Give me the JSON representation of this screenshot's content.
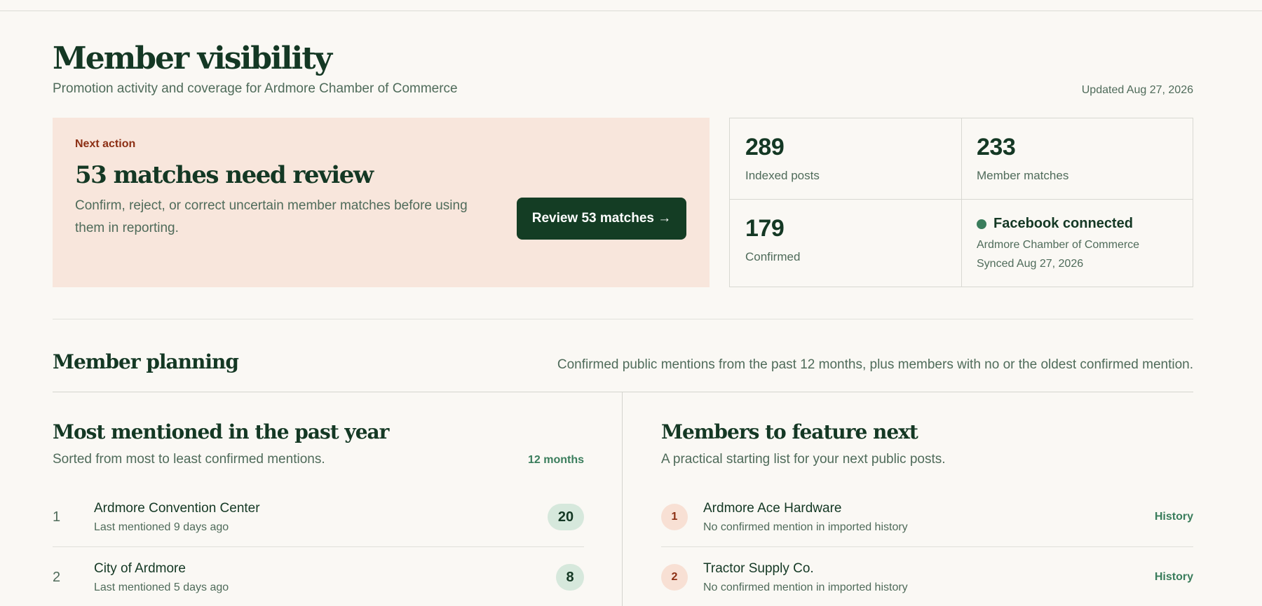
{
  "header": {
    "title": "Member visibility",
    "subtitle": "Promotion activity and coverage for Ardmore Chamber of Commerce",
    "updated": "Updated Aug 27, 2026"
  },
  "next_action": {
    "eyebrow": "Next action",
    "title": "53 matches need review",
    "description": "Confirm, reject, or correct uncertain member matches before using them in reporting.",
    "button_label": "Review 53 matches →"
  },
  "stats": {
    "indexed_posts": {
      "value": "289",
      "label": "Indexed posts"
    },
    "member_matches": {
      "value": "233",
      "label": "Member matches"
    },
    "confirmed": {
      "value": "179",
      "label": "Confirmed"
    },
    "facebook": {
      "status": "Facebook connected",
      "org": "Ardmore Chamber of Commerce",
      "synced": "Synced Aug 27, 2026",
      "status_color": "#3a7d5c"
    }
  },
  "planning": {
    "title": "Member planning",
    "description": "Confirmed public mentions from the past 12 months, plus members with no or the oldest confirmed mention."
  },
  "most_mentioned": {
    "title": "Most mentioned in the past year",
    "subtitle": "Sorted from most to least confirmed mentions.",
    "tag": "12 months",
    "rows": [
      {
        "rank": "1",
        "name": "Ardmore Convention Center",
        "meta": "Last mentioned 9 days ago",
        "count": "20"
      },
      {
        "rank": "2",
        "name": "City of Ardmore",
        "meta": "Last mentioned 5 days ago",
        "count": "8"
      }
    ]
  },
  "feature_next": {
    "title": "Members to feature next",
    "subtitle": "A practical starting list for your next public posts.",
    "rows": [
      {
        "rank": "1",
        "name": "Ardmore Ace Hardware",
        "meta": "No confirmed mention in imported history",
        "action": "History"
      },
      {
        "rank": "2",
        "name": "Tractor Supply Co.",
        "meta": "No confirmed mention in imported history",
        "action": "History"
      }
    ]
  }
}
